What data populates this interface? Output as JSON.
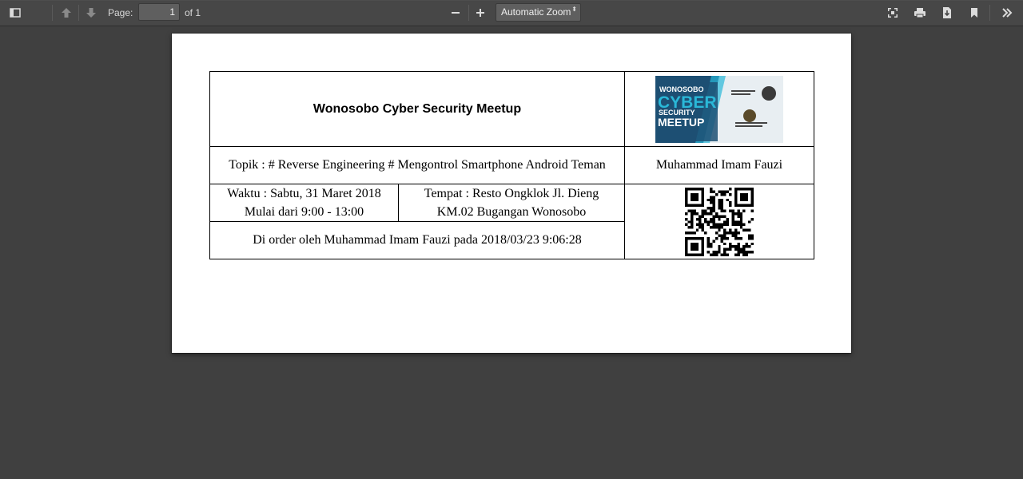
{
  "toolbar": {
    "page_label": "Page:",
    "page_value": "1",
    "page_of": "of 1",
    "zoom_value": "Automatic Zoom",
    "zoom_arrow": "⬍"
  },
  "ticket": {
    "title": "Wonosobo Cyber Security Meetup",
    "banner": {
      "line1": "WONOSOBO",
      "line2": "CYBER",
      "line3": "SECURITY",
      "line4": "MEETUP",
      "colors": {
        "bg": "#1d4f73",
        "accent": "#2ab8d8",
        "text": "#ffffff"
      }
    },
    "topic": "Topik : # Reverse Engineering # Mengontrol Smartphone Android Teman",
    "speaker": "Muhammad Imam Fauzi",
    "time_line1": "Waktu : Sabtu, 31 Maret 2018",
    "time_line2": "Mulai dari 9:00 - 13:00",
    "place_line1": "Tempat : Resto Ongklok Jl. Dieng",
    "place_line2": "KM.02 Bugangan Wonosobo",
    "order": "Di order oleh Muhammad Imam Fauzi pada 2018/03/23 9:06:28"
  },
  "colors": {
    "toolbar_bg": "#474747",
    "viewer_bg": "#404040",
    "page_bg": "#ffffff"
  }
}
